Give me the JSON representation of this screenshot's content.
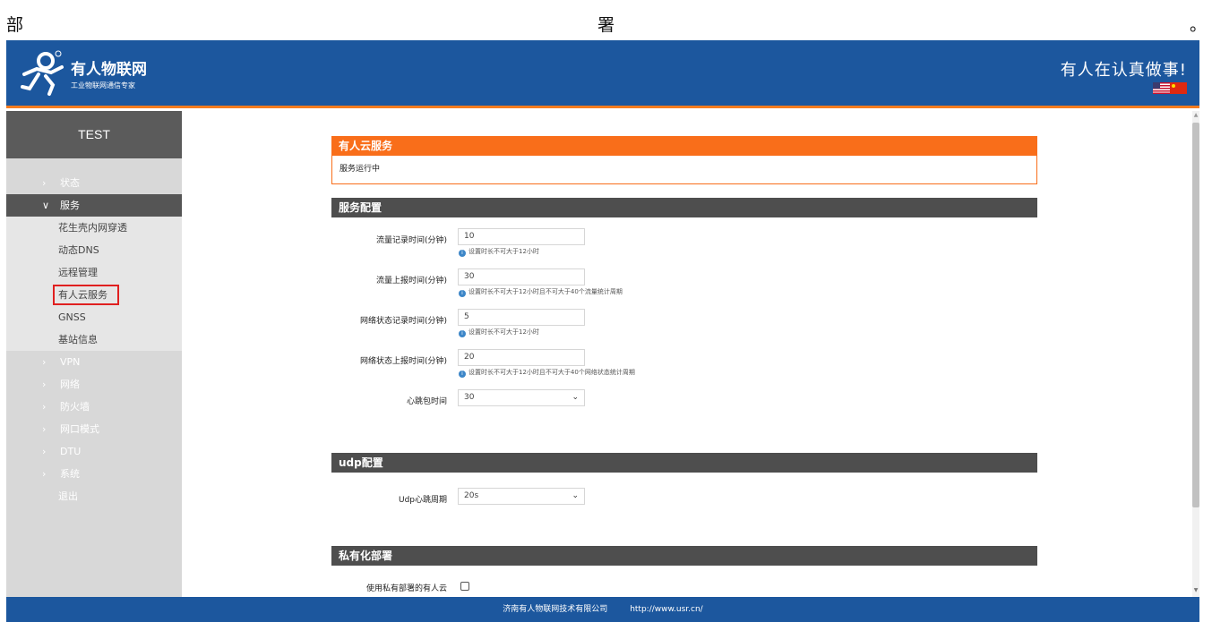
{
  "document": {
    "left_char": "部",
    "mid_char": "署",
    "right_char": "。"
  },
  "header": {
    "brand_name": "有人物联网",
    "brand_sub": "工业物联网通信专家",
    "slogan": "有人在认真做事!",
    "flags": [
      "us-flag-icon",
      "cn-flag-icon"
    ]
  },
  "sidebar": {
    "device_title": "TEST",
    "items": [
      {
        "label": "状态",
        "kind": "top"
      },
      {
        "label": "服务",
        "kind": "open"
      },
      {
        "label": "花生壳内网穿透",
        "kind": "sub"
      },
      {
        "label": "动态DNS",
        "kind": "sub"
      },
      {
        "label": "远程管理",
        "kind": "sub"
      },
      {
        "label": "有人云服务",
        "kind": "sub",
        "active": true
      },
      {
        "label": "GNSS",
        "kind": "sub"
      },
      {
        "label": "基站信息",
        "kind": "sub"
      },
      {
        "label": "VPN",
        "kind": "top"
      },
      {
        "label": "网络",
        "kind": "top"
      },
      {
        "label": "防火墙",
        "kind": "top"
      },
      {
        "label": "网口模式",
        "kind": "top"
      },
      {
        "label": "DTU",
        "kind": "top"
      },
      {
        "label": "系统",
        "kind": "top"
      },
      {
        "label": "退出",
        "kind": "logout"
      }
    ]
  },
  "main": {
    "service_panel": {
      "title": "有人云服务",
      "status": "服务运行中"
    },
    "service_config": {
      "title": "服务配置",
      "fields": [
        {
          "label": "流量记录时间(分钟)",
          "value": "10",
          "hint": "设置时长不可大于12小时"
        },
        {
          "label": "流量上报时间(分钟)",
          "value": "30",
          "hint": "设置时长不可大于12小时且不可大于40个流量统计周期"
        },
        {
          "label": "网络状态记录时间(分钟)",
          "value": "5",
          "hint": "设置时长不可大于12小时"
        },
        {
          "label": "网络状态上报时间(分钟)",
          "value": "20",
          "hint": "设置时长不可大于12小时且不可大于40个网络状态统计周期"
        }
      ],
      "heartbeat": {
        "label": "心跳包时间",
        "value": "30"
      }
    },
    "udp_config": {
      "title": "udp配置",
      "period_label": "Udp心跳周期",
      "period_value": "20s"
    },
    "private_deploy": {
      "title": "私有化部署",
      "checkbox_label": "使用私有部署的有人云",
      "checked": false
    }
  },
  "footer": {
    "company": "济南有人物联网技术有限公司",
    "url": "http://www.usr.cn/"
  },
  "colors": {
    "header_blue": "#1c579e",
    "accent_orange": "#f96e1a",
    "sidebar_dark": "#555555"
  }
}
